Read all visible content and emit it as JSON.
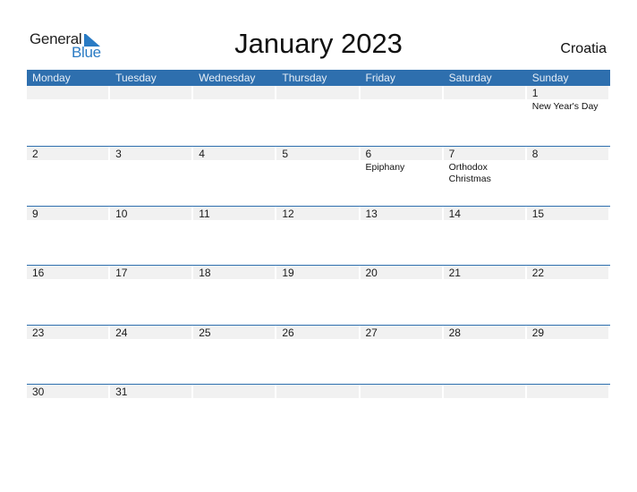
{
  "brand": {
    "general": "General",
    "blue": "Blue",
    "accent": "#2a7bc4"
  },
  "title": "January 2023",
  "country": "Croatia",
  "colors": {
    "header_bg": "#2e6fae",
    "day_bar": "#f1f1f1"
  },
  "weekdays": [
    "Monday",
    "Tuesday",
    "Wednesday",
    "Thursday",
    "Friday",
    "Saturday",
    "Sunday"
  ],
  "weeks": [
    [
      {
        "day": ""
      },
      {
        "day": ""
      },
      {
        "day": ""
      },
      {
        "day": ""
      },
      {
        "day": ""
      },
      {
        "day": ""
      },
      {
        "day": "1",
        "event": "New Year's Day"
      }
    ],
    [
      {
        "day": "2"
      },
      {
        "day": "3"
      },
      {
        "day": "4"
      },
      {
        "day": "5"
      },
      {
        "day": "6",
        "event": "Epiphany"
      },
      {
        "day": "7",
        "event": "Orthodox Christmas"
      },
      {
        "day": "8"
      }
    ],
    [
      {
        "day": "9"
      },
      {
        "day": "10"
      },
      {
        "day": "11"
      },
      {
        "day": "12"
      },
      {
        "day": "13"
      },
      {
        "day": "14"
      },
      {
        "day": "15"
      }
    ],
    [
      {
        "day": "16"
      },
      {
        "day": "17"
      },
      {
        "day": "18"
      },
      {
        "day": "19"
      },
      {
        "day": "20"
      },
      {
        "day": "21"
      },
      {
        "day": "22"
      }
    ],
    [
      {
        "day": "23"
      },
      {
        "day": "24"
      },
      {
        "day": "25"
      },
      {
        "day": "26"
      },
      {
        "day": "27"
      },
      {
        "day": "28"
      },
      {
        "day": "29"
      }
    ],
    [
      {
        "day": "30"
      },
      {
        "day": "31"
      },
      {
        "day": ""
      },
      {
        "day": ""
      },
      {
        "day": ""
      },
      {
        "day": ""
      },
      {
        "day": ""
      }
    ]
  ]
}
